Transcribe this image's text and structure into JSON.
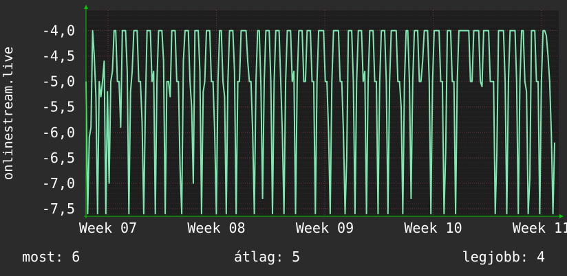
{
  "stats": {
    "now_label": "most:",
    "now_value": "6",
    "avg_label": "átlag:",
    "avg_value": "5",
    "best_label": "legjobb:",
    "best_value": "4"
  },
  "colors": {
    "background": "#2b2b2b",
    "plot_background": "#1e1e1e",
    "line": "#7fe8b0",
    "axis_arrow": "#00cc00",
    "text": "#ffffff"
  },
  "chart_data": {
    "type": "line",
    "title": "",
    "xlabel": "",
    "ylabel": "onlinestream.live",
    "ylim": [
      -7.65,
      -3.6
    ],
    "y_ticks": [
      -4.0,
      -4.5,
      -5.0,
      -5.5,
      -6.0,
      -6.5,
      -7.0,
      -7.5
    ],
    "y_tick_labels": [
      "-4,0",
      "-4,5",
      "-5,0",
      "-5,5",
      "-6,0",
      "-6,5",
      "-7,0",
      "-7,5"
    ],
    "x_tick_labels": [
      "Week 07",
      "Week 08",
      "Week 09",
      "Week 10",
      "Week 11"
    ],
    "grid": true,
    "series": [
      {
        "values": [
          -5.0,
          -7.6,
          -6.1,
          -5.9,
          -4.0,
          -4.5,
          -5.3,
          -7.6,
          -5.0,
          -5.3,
          -5.0,
          -4.6,
          -7.6,
          -5.2,
          -7.0,
          -5.0,
          -4.8,
          -4.0,
          -4.0,
          -5.0,
          -5.0,
          -5.9,
          -4.0,
          -4.0,
          -4.0,
          -4.8,
          -7.6,
          -5.2,
          -4.8,
          -4.0,
          -4.0,
          -4.0,
          -5.0,
          -5.0,
          -5.8,
          -7.6,
          -5.5,
          -4.0,
          -4.0,
          -4.0,
          -5.0,
          -4.8,
          -7.6,
          -5.0,
          -4.0,
          -4.0,
          -4.0,
          -4.6,
          -7.6,
          -5.0,
          -5.0,
          -5.3,
          -4.0,
          -4.0,
          -4.0,
          -5.0,
          -5.0,
          -6.7,
          -7.6,
          -4.6,
          -4.0,
          -4.0,
          -4.0,
          -5.0,
          -5.5,
          -7.0,
          -4.0,
          -4.0,
          -4.0,
          -4.8,
          -7.6,
          -5.2,
          -5.0,
          -4.0,
          -4.0,
          -4.0,
          -5.0,
          -5.0,
          -6.0,
          -7.6,
          -5.0,
          -4.0,
          -4.0,
          -5.0,
          -5.3,
          -7.6,
          -5.0,
          -4.0,
          -4.0,
          -4.0,
          -4.8,
          -7.6,
          -5.0,
          -5.0,
          -4.0,
          -4.0,
          -4.0,
          -4.0,
          -4.6,
          -5.0,
          -5.0,
          -6.0,
          -7.6,
          -5.0,
          -4.0,
          -4.0,
          -5.1,
          -7.3,
          -5.0,
          -4.0,
          -4.0,
          -4.0,
          -5.0,
          -7.6,
          -5.0,
          -4.0,
          -4.0,
          -4.0,
          -5.0,
          -6.0,
          -7.6,
          -5.0,
          -4.0,
          -4.0,
          -4.0,
          -5.0,
          -4.8,
          -7.6,
          -5.0,
          -4.0,
          -4.0,
          -4.0,
          -5.0,
          -5.0,
          -4.0,
          -4.0,
          -4.0,
          -5.0,
          -5.0,
          -7.6,
          -5.0,
          -4.0,
          -4.0,
          -4.0,
          -4.0,
          -5.0,
          -5.0,
          -6.0,
          -7.6,
          -5.0,
          -4.0,
          -4.0,
          -4.0,
          -4.0,
          -5.0,
          -5.0,
          -6.0,
          -7.6,
          -6.5,
          -4.0,
          -4.0,
          -4.0,
          -5.0,
          -7.6,
          -5.0,
          -4.0,
          -4.0,
          -4.0,
          -5.0,
          -4.8,
          -7.6,
          -5.0,
          -4.0,
          -4.0,
          -4.0,
          -5.0,
          -5.0,
          -7.6,
          -5.0,
          -4.0,
          -4.0,
          -4.0,
          -5.0,
          -7.6,
          -5.0,
          -4.0,
          -4.0,
          -4.0,
          -4.0,
          -5.0,
          -5.0,
          -5.5,
          -7.6,
          -5.0,
          -4.0,
          -4.0,
          -5.0,
          -7.3,
          -5.0,
          -4.0,
          -4.0,
          -4.0,
          -5.0,
          -5.0,
          -4.6,
          -4.0,
          -4.0,
          -4.0,
          -5.0,
          -7.6,
          -5.0,
          -4.0,
          -4.0,
          -4.0,
          -4.0,
          -5.0,
          -5.0,
          -7.6,
          -6.4,
          -4.0,
          -4.0,
          -4.0,
          -5.0,
          -5.0,
          -7.6,
          -5.0,
          -4.0,
          -4.0,
          -4.0,
          -4.0,
          -4.0,
          -4.0,
          -4.0,
          -5.0,
          -5.0,
          -4.0,
          -4.0,
          -4.0,
          -4.0,
          -5.0,
          -5.1,
          -4.0,
          -4.0,
          -4.0,
          -4.0,
          -5.0,
          -5.0,
          -5.0,
          -7.6,
          -6.4,
          -4.0,
          -4.0,
          -4.0,
          -4.0,
          -5.0,
          -7.6,
          -5.0,
          -4.0,
          -4.0,
          -4.0,
          -4.0,
          -5.0,
          -7.6,
          -5.0,
          -4.0,
          -4.0,
          -5.0,
          -5.2,
          -7.6,
          -6.9,
          -4.0,
          -4.0,
          -4.0,
          -5.0,
          -5.0,
          -7.6,
          -5.0,
          -4.0,
          -4.0,
          -4.1,
          -4.5,
          -5.0,
          -6.0,
          -7.6,
          -6.2
        ]
      }
    ]
  }
}
